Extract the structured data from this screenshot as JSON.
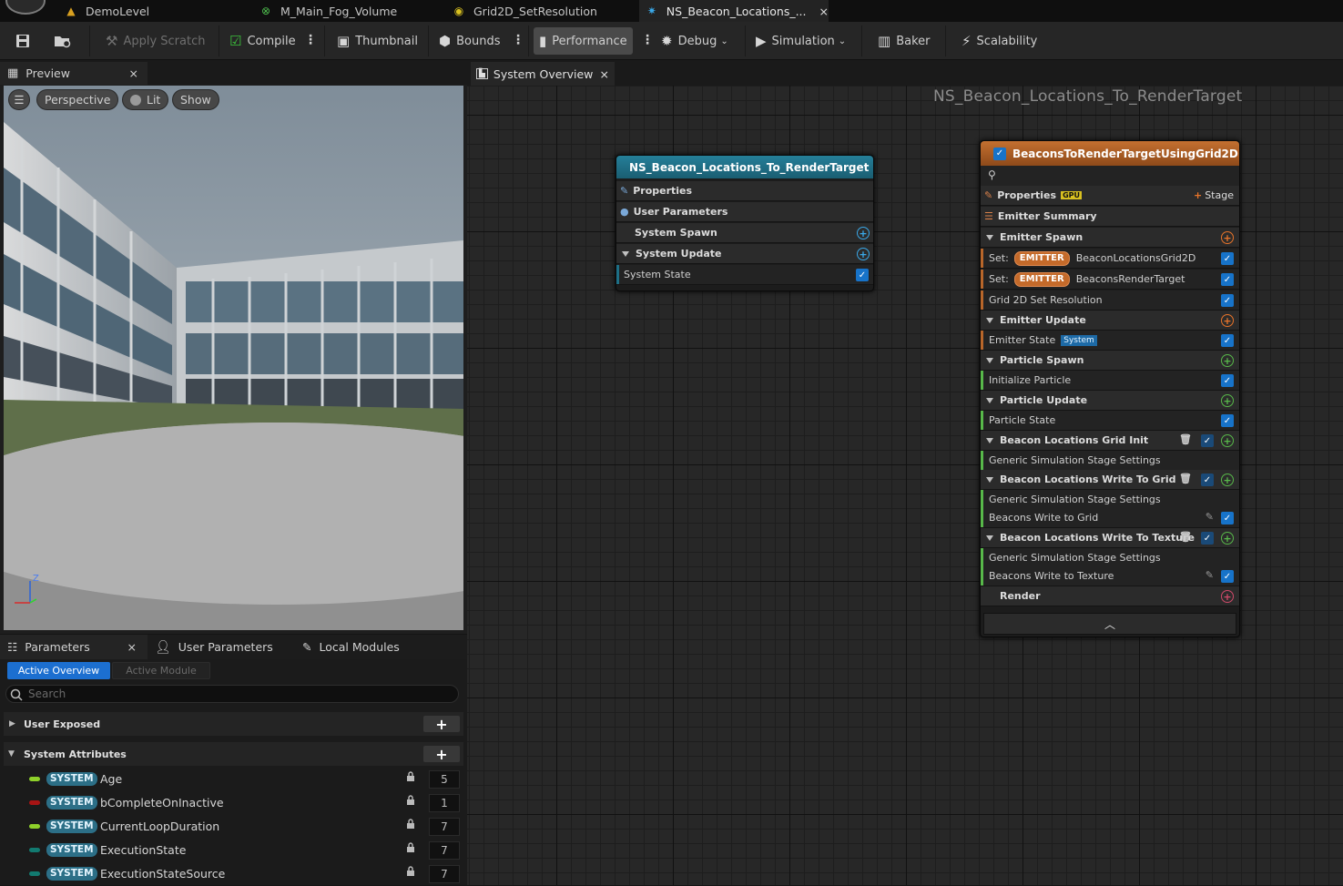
{
  "doc_tabs": [
    {
      "label": "DemoLevel",
      "icon": "level-icon"
    },
    {
      "label": "M_Main_Fog_Volume",
      "icon": "material-icon"
    },
    {
      "label": "Grid2D_SetResolution",
      "icon": "script-icon"
    },
    {
      "label": "NS_Beacon_Locations_...",
      "icon": "niagara-system-icon",
      "close": "×"
    }
  ],
  "toolbar": {
    "apply_scratch": "Apply Scratch",
    "compile": "Compile",
    "thumbnail": "Thumbnail",
    "bounds": "Bounds",
    "performance": "Performance",
    "debug": "Debug",
    "simulation": "Simulation",
    "baker": "Baker",
    "scalability": "Scalability"
  },
  "preview": {
    "tab_label": "Preview",
    "close": "×",
    "perspective": "Perspective",
    "lit": "Lit",
    "show": "Show",
    "axis_z": "Z"
  },
  "params": {
    "tab_parameters": "Parameters",
    "tab_close": "×",
    "tab_user_parameters": "User Parameters",
    "tab_local_modules": "Local Modules",
    "active_overview": "Active Overview",
    "active_module": "Active Module",
    "search_placeholder": "Search",
    "section_user_exposed": "User Exposed",
    "section_system_attributes": "System Attributes",
    "plus": "+",
    "attributes": [
      {
        "badge": "SYSTEM",
        "name": "Age",
        "value": "5",
        "color": "#8ed02a"
      },
      {
        "badge": "SYSTEM",
        "name": "bCompleteOnInactive",
        "value": "1",
        "color": "#a81414"
      },
      {
        "badge": "SYSTEM",
        "name": "CurrentLoopDuration",
        "value": "7",
        "color": "#8ed02a"
      },
      {
        "badge": "SYSTEM",
        "name": "ExecutionState",
        "value": "7",
        "color": "#127a70"
      },
      {
        "badge": "SYSTEM",
        "name": "ExecutionStateSource",
        "value": "7",
        "color": "#127a70"
      }
    ]
  },
  "graph": {
    "tab_label": "System Overview",
    "tab_close": "×",
    "title": "NS_Beacon_Locations_To_RenderTarget"
  },
  "system_node": {
    "title": "NS_Beacon_Locations_To_RenderTarget",
    "rows": {
      "properties": "Properties",
      "user_parameters": "User Parameters",
      "system_spawn": "System Spawn",
      "system_update": "System Update",
      "system_state": "System State"
    }
  },
  "emitter_node": {
    "title": "BeaconsToRenderTargetUsingGrid2D",
    "properties": "Properties",
    "gpu_badge": "GPU",
    "stage_btn": "Stage",
    "emitter_summary": "Emitter Summary",
    "emitter_spawn": "Emitter Spawn",
    "set_label": "Set:",
    "emitter_badge": "EMITTER",
    "set1_value": "BeaconLocationsGrid2D",
    "set2_value": "BeaconsRenderTarget",
    "grid2d_set_resolution": "Grid 2D Set Resolution",
    "emitter_update": "Emitter Update",
    "emitter_state": "Emitter State",
    "system_mini": "System",
    "particle_spawn": "Particle Spawn",
    "initialize_particle": "Initialize Particle",
    "particle_update": "Particle Update",
    "particle_state": "Particle State",
    "stage1": "Beacon Locations Grid Init",
    "generic1": "Generic Simulation Stage Settings",
    "stage2": "Beacon Locations Write To Grid",
    "generic2": "Generic Simulation Stage Settings",
    "beacons_write_grid": "Beacons Write to Grid",
    "stage3": "Beacon Locations Write To Texture",
    "generic3": "Generic Simulation Stage Settings",
    "beacons_write_texture": "Beacons Write to Texture",
    "render": "Render"
  },
  "colors": {
    "system_node_header": "#1d6f86",
    "emitter_node_header": "#b8662a",
    "accent_blue": "#1773c9"
  }
}
